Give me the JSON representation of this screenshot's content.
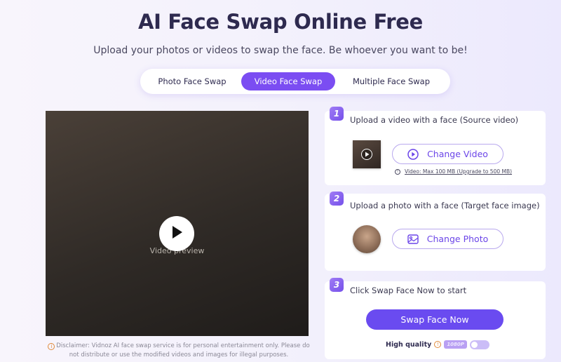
{
  "header": {
    "title": "AI Face Swap Online Free",
    "subtitle": "Upload your photos or videos to swap the face. Be whoever you want to be!"
  },
  "tabs": [
    {
      "label": "Photo Face Swap",
      "active": false
    },
    {
      "label": "Video Face Swap",
      "active": true
    },
    {
      "label": "Multiple Face Swap",
      "active": false
    }
  ],
  "preview": {
    "placeholder_label": "Video preview",
    "play_icon": "play-icon"
  },
  "disclaimer": {
    "icon": "info-icon",
    "text": "Disclaimer: Vidnoz AI face swap service is for personal entertainment only. Please do not distribute or use the modified videos and images for illegal purposes."
  },
  "steps": [
    {
      "number": "1",
      "text": "Upload a video with a face (Source video)",
      "button_label": "Change Video",
      "button_icon": "play-circle-icon",
      "note": "Video: Max 100 MB (Upgrade to 500 MB)"
    },
    {
      "number": "2",
      "text": "Upload a photo with a face (Target face image)",
      "button_label": "Change Photo",
      "button_icon": "image-icon"
    },
    {
      "number": "3",
      "text": "Click Swap Face Now to start",
      "button_label": "Swap Face Now"
    }
  ],
  "quality": {
    "label": "High quality",
    "badge": "1080P",
    "enabled": false
  },
  "colors": {
    "accent": "#7b4df2",
    "primary_button": "#6a4bf0",
    "warning": "#e08a3a"
  }
}
